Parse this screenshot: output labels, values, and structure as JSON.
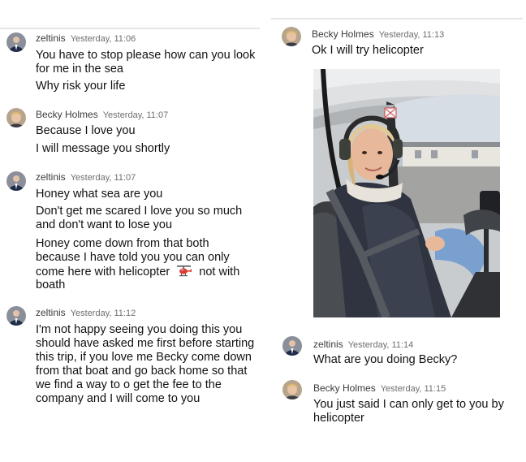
{
  "left_messages": [
    {
      "sender": "zeltinis",
      "time": "Yesterday, 11:06",
      "lines": [
        "You have to stop please how can you look",
        "for me in the sea",
        "Why risk your life"
      ]
    },
    {
      "sender": "Becky Holmes",
      "time": "Yesterday, 11:07",
      "lines": [
        "Because I love you",
        "I will message you shortly"
      ]
    },
    {
      "sender": "zeltinis",
      "time": "Yesterday, 11:07",
      "lines": [
        "Honey what sea are you",
        "Don't get me scared I love you so much",
        "and don't want to lose you",
        "Honey come down from that both",
        "because I  have told you you can only",
        "come  here with helicopter",
        "not with",
        "boath"
      ]
    },
    {
      "sender": "zeltinis",
      "time": "Yesterday, 11:12",
      "lines": [
        "I'm not happy seeing you doing this you",
        "should have asked me first before starting",
        "this trip, if you love me Becky come down",
        "from that boat and go back home so that",
        "we find a way to o get the fee to the",
        "company and I will come to you"
      ]
    }
  ],
  "right_messages": [
    {
      "sender": "Becky Holmes",
      "time": "Yesterday, 11:13",
      "lines": [
        "Ok I will try helicopter"
      ]
    },
    {
      "sender": "zeltinis",
      "time": "Yesterday, 11:14",
      "lines": [
        "What are you doing Becky?"
      ]
    },
    {
      "sender": "Becky Holmes",
      "time": "Yesterday, 11:15",
      "lines": [
        "You just said I can only get to you by",
        "helicopter"
      ]
    }
  ],
  "icons": {
    "helicopter": "helicopter-emoji",
    "avatar_zeltinis": "man-in-suit-avatar",
    "avatar_becky": "woman-avatar"
  }
}
